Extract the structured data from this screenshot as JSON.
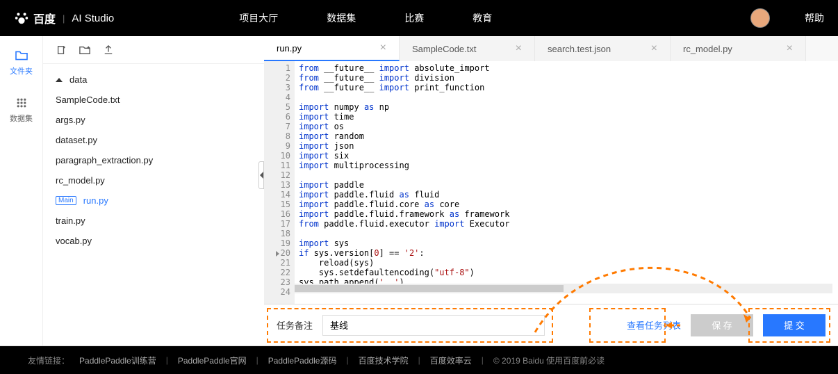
{
  "header": {
    "logo_main": "百度",
    "logo_sub": "AI Studio",
    "nav": [
      "项目大厅",
      "数据集",
      "比赛",
      "教育"
    ],
    "help": "帮助"
  },
  "rail": {
    "files": "文件夹",
    "datasets": "数据集"
  },
  "tree": {
    "folder": "data",
    "files": [
      "SampleCode.txt",
      "args.py",
      "dataset.py",
      "paragraph_extraction.py",
      "rc_model.py"
    ],
    "main_tag": "Main",
    "main_file": "run.py",
    "files2": [
      "train.py",
      "vocab.py"
    ]
  },
  "tabs": [
    "run.py",
    "SampleCode.txt",
    "search.test.json",
    "rc_model.py"
  ],
  "code_lines": [
    [
      [
        "kw-from",
        "from"
      ],
      [
        "",
        " __future__ "
      ],
      [
        "kw-import",
        "import"
      ],
      [
        "",
        " absolute_import"
      ]
    ],
    [
      [
        "kw-from",
        "from"
      ],
      [
        "",
        " __future__ "
      ],
      [
        "kw-import",
        "import"
      ],
      [
        "",
        " division"
      ]
    ],
    [
      [
        "kw-from",
        "from"
      ],
      [
        "",
        " __future__ "
      ],
      [
        "kw-import",
        "import"
      ],
      [
        "",
        " print_function"
      ]
    ],
    [],
    [
      [
        "kw-import",
        "import"
      ],
      [
        "",
        " numpy "
      ],
      [
        "kw-as",
        "as"
      ],
      [
        "",
        " np"
      ]
    ],
    [
      [
        "kw-import",
        "import"
      ],
      [
        "",
        " time"
      ]
    ],
    [
      [
        "kw-import",
        "import"
      ],
      [
        "",
        " os"
      ]
    ],
    [
      [
        "kw-import",
        "import"
      ],
      [
        "",
        " random"
      ]
    ],
    [
      [
        "kw-import",
        "import"
      ],
      [
        "",
        " json"
      ]
    ],
    [
      [
        "kw-import",
        "import"
      ],
      [
        "",
        " six"
      ]
    ],
    [
      [
        "kw-import",
        "import"
      ],
      [
        "",
        " multiprocessing"
      ]
    ],
    [],
    [
      [
        "kw-import",
        "import"
      ],
      [
        "",
        " paddle"
      ]
    ],
    [
      [
        "kw-import",
        "import"
      ],
      [
        "",
        " paddle.fluid "
      ],
      [
        "kw-as",
        "as"
      ],
      [
        "",
        " fluid"
      ]
    ],
    [
      [
        "kw-import",
        "import"
      ],
      [
        "",
        " paddle.fluid.core "
      ],
      [
        "kw-as",
        "as"
      ],
      [
        "",
        " core"
      ]
    ],
    [
      [
        "kw-import",
        "import"
      ],
      [
        "",
        " paddle.fluid.framework "
      ],
      [
        "kw-as",
        "as"
      ],
      [
        "",
        " framework"
      ]
    ],
    [
      [
        "kw-from",
        "from"
      ],
      [
        "",
        " paddle.fluid.executor "
      ],
      [
        "kw-import",
        "import"
      ],
      [
        "",
        " Executor"
      ]
    ],
    [],
    [
      [
        "kw-import",
        "import"
      ],
      [
        "",
        " sys"
      ]
    ],
    [
      [
        "kw-if",
        "if"
      ],
      [
        "",
        " sys.version["
      ],
      [
        "num",
        "0"
      ],
      [
        "",
        "] == "
      ],
      [
        "str",
        "'2'"
      ],
      [
        "",
        ":"
      ]
    ],
    [
      [
        "",
        "    reload(sys)"
      ]
    ],
    [
      [
        "",
        "    sys.setdefaultencoding("
      ],
      [
        "str",
        "\"utf-8\""
      ],
      [
        "",
        ")"
      ]
    ],
    [
      [
        "",
        "sys.path.append("
      ],
      [
        "str",
        "'..'"
      ],
      [
        "",
        ")"
      ]
    ],
    []
  ],
  "bottom": {
    "task_label": "任务备注",
    "task_value": "基线",
    "view_list": "查看任务列表",
    "save": "保 存",
    "submit": "提 交"
  },
  "footer": {
    "prefix": "友情链接：",
    "links": [
      "PaddlePaddle训练营",
      "PaddlePaddle官网",
      "PaddlePaddle源码",
      "百度技术学院",
      "百度效率云"
    ],
    "copyright": "© 2019 Baidu 使用百度前必读"
  }
}
